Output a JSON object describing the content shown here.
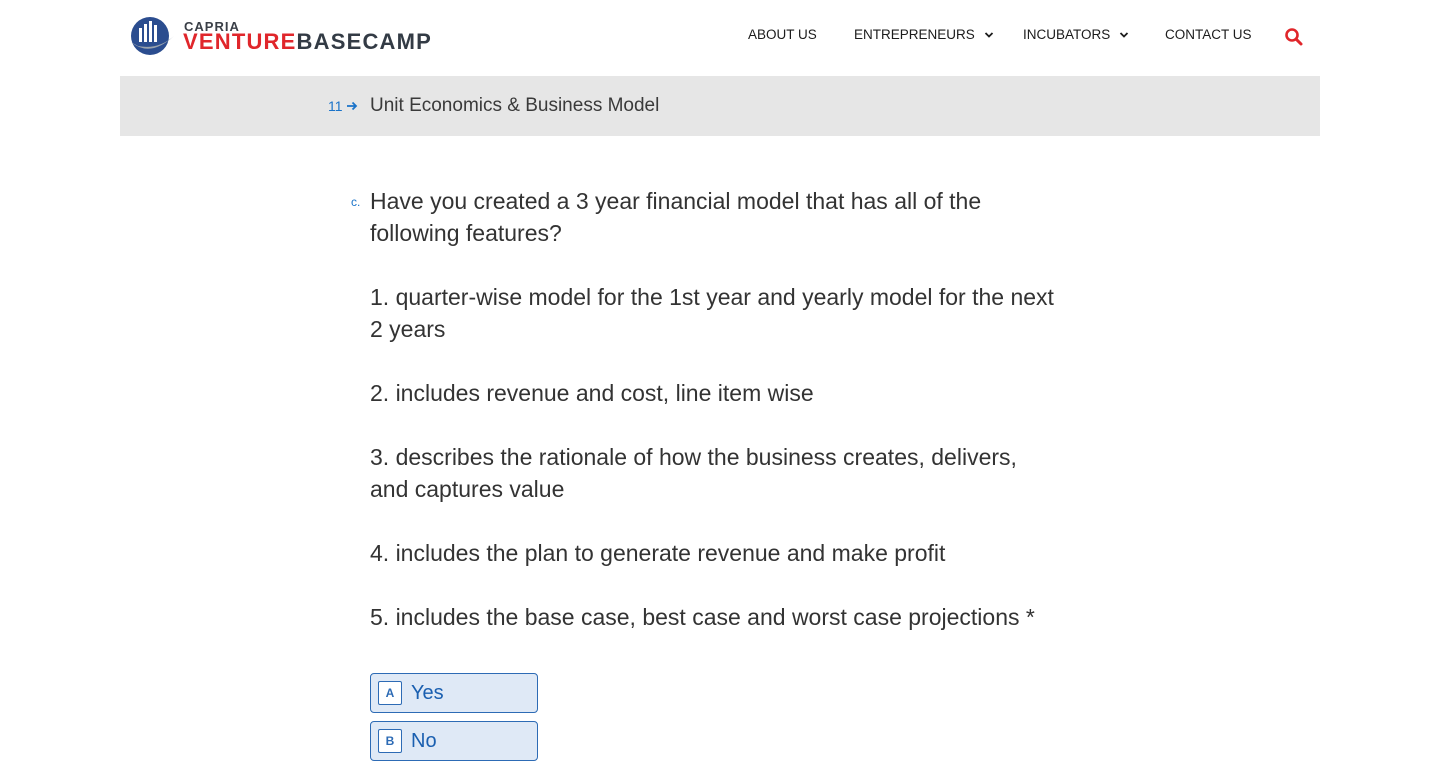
{
  "brand": {
    "small": "CAPRIA",
    "big_red": "VENTURE",
    "big_dark": "BASECAMP",
    "colors": {
      "red": "#e0262b",
      "dark": "#333b45"
    }
  },
  "nav": {
    "items": [
      {
        "label": "ABOUT US",
        "has_dropdown": false
      },
      {
        "label": "ENTREPRENEURS",
        "has_dropdown": true
      },
      {
        "label": "INCUBATORS",
        "has_dropdown": true
      },
      {
        "label": "CONTACT US",
        "has_dropdown": false
      }
    ],
    "search_icon": "search-icon",
    "search_color": "#e0262b"
  },
  "section": {
    "number": "11",
    "title": "Unit Economics & Business Model"
  },
  "question": {
    "letter": "c.",
    "paragraphs": [
      "Have you created a 3 year financial model that has all of the following features?",
      "1. quarter-wise model for the 1st year and yearly model for the next 2 years",
      "2. includes revenue and cost, line item wise",
      "3. describes the rationale of how the business creates, delivers, and captures value",
      "4. includes the plan to generate revenue and make profit",
      "5. includes the base case, best case and worst case projections"
    ],
    "required_mark": "*"
  },
  "options": [
    {
      "key": "A",
      "label": "Yes"
    },
    {
      "key": "B",
      "label": "No"
    }
  ],
  "colors": {
    "accent": "#1a73c9",
    "option_bg": "#dfe9f6",
    "option_border": "#2d6bb5",
    "section_bg": "#e6e6e6"
  }
}
